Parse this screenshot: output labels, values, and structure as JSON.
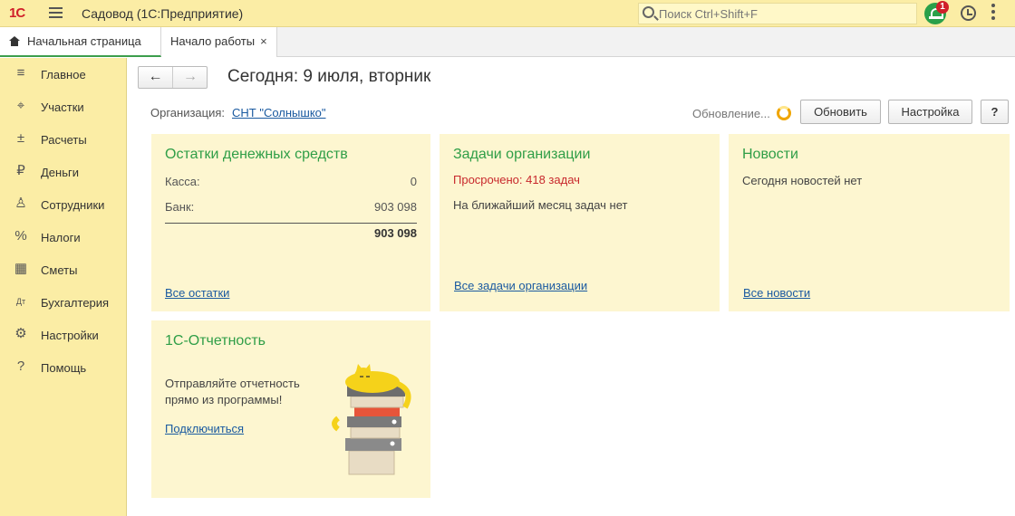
{
  "header": {
    "logo": "1С",
    "app_title": "Садовод  (1С:Предприятие)",
    "search_placeholder": "Поиск Ctrl+Shift+F",
    "notification_count": "1"
  },
  "tabs": [
    {
      "label": "Начальная страница"
    },
    {
      "label": "Начало работы",
      "close": "×"
    }
  ],
  "sidebar": {
    "items": [
      {
        "label": "Главное",
        "icon": "menu-icon"
      },
      {
        "label": "Участки",
        "icon": "map-pin-icon"
      },
      {
        "label": "Расчеты",
        "icon": "calc-icon"
      },
      {
        "label": "Деньги",
        "icon": "ruble-icon"
      },
      {
        "label": "Сотрудники",
        "icon": "person-icon"
      },
      {
        "label": "Налоги",
        "icon": "percent-icon"
      },
      {
        "label": "Сметы",
        "icon": "calculator-icon"
      },
      {
        "label": "Бухгалтерия",
        "icon": "dt-kt-icon"
      },
      {
        "label": "Настройки",
        "icon": "gear-icon"
      },
      {
        "label": "Помощь",
        "icon": "question-icon"
      }
    ]
  },
  "page": {
    "title": "Сегодня: 9 июля, вторник",
    "org_label": "Организация:",
    "org_value": "СНТ \"Солнышко\"",
    "update_label": "Обновление...",
    "refresh_button": "Обновить",
    "settings_button": "Настройка",
    "help_button": "?"
  },
  "balances": {
    "title": "Остатки денежных средств",
    "rows": [
      {
        "label": "Касса:",
        "value": "0"
      },
      {
        "label": "Банк:",
        "value": "903 098"
      }
    ],
    "total": "903 098",
    "link": "Все остатки"
  },
  "tasks": {
    "title": "Задачи организации",
    "overdue": "Просрочено: 418 задач",
    "upcoming": "На ближайший месяц задач нет",
    "link": "Все задачи организации"
  },
  "news": {
    "title": "Новости",
    "empty": "Сегодня новостей нет",
    "link": "Все новости"
  },
  "reporting": {
    "title": "1С-Отчетность",
    "line1": "Отправляйте отчетность",
    "line2": "прямо из программы!",
    "link": "Подключиться"
  }
}
